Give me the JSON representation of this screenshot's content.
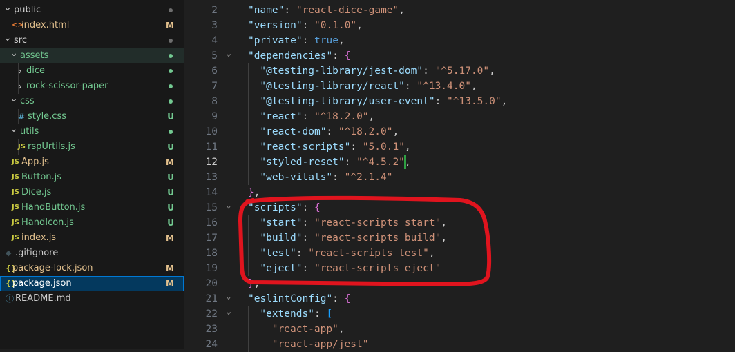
{
  "explorer": {
    "items": [
      {
        "label": "public",
        "icon": "chevron-down-icon",
        "status": "dot",
        "status_color": "#6e6e6e"
      },
      {
        "label": "index.html",
        "icon": "html-file-icon",
        "status": "M",
        "status_color": "#e2c08d",
        "label_color": "#e2c08d"
      },
      {
        "label": "src",
        "icon": "chevron-down-icon",
        "status": "dot",
        "status_color": "#6e6e6e"
      },
      {
        "label": "assets",
        "icon": "chevron-down-icon",
        "status": "dot",
        "status_color": "#73c991",
        "label_color": "#73c991"
      },
      {
        "label": "dice",
        "icon": "chevron-right-icon",
        "status": "dot",
        "status_color": "#73c991",
        "label_color": "#73c991"
      },
      {
        "label": "rock-scissor-paper",
        "icon": "chevron-right-icon",
        "status": "dot",
        "status_color": "#73c991",
        "label_color": "#73c991"
      },
      {
        "label": "css",
        "icon": "chevron-down-icon",
        "status": "dot",
        "status_color": "#73c991",
        "label_color": "#73c991"
      },
      {
        "label": "style.css",
        "icon": "css-file-icon",
        "icon_text": "#",
        "status": "U",
        "status_color": "#73c991",
        "label_color": "#73c991"
      },
      {
        "label": "utils",
        "icon": "chevron-down-icon",
        "status": "dot",
        "status_color": "#73c991",
        "label_color": "#73c991"
      },
      {
        "label": "rspUrtils.js",
        "icon": "js-file-icon",
        "icon_text": "JS",
        "status": "U",
        "status_color": "#73c991",
        "label_color": "#73c991"
      },
      {
        "label": "App.js",
        "icon": "js-file-icon",
        "icon_text": "JS",
        "status": "M",
        "status_color": "#e2c08d",
        "label_color": "#e2c08d"
      },
      {
        "label": "Button.js",
        "icon": "js-file-icon",
        "icon_text": "JS",
        "status": "U",
        "status_color": "#73c991",
        "label_color": "#73c991"
      },
      {
        "label": "Dice.js",
        "icon": "js-file-icon",
        "icon_text": "JS",
        "status": "U",
        "status_color": "#73c991",
        "label_color": "#73c991"
      },
      {
        "label": "HandButton.js",
        "icon": "js-file-icon",
        "icon_text": "JS",
        "status": "U",
        "status_color": "#73c991",
        "label_color": "#73c991"
      },
      {
        "label": "HandIcon.js",
        "icon": "js-file-icon",
        "icon_text": "JS",
        "status": "U",
        "status_color": "#73c991",
        "label_color": "#73c991"
      },
      {
        "label": "index.js",
        "icon": "js-file-icon",
        "icon_text": "JS",
        "status": "M",
        "status_color": "#e2c08d",
        "label_color": "#e2c08d"
      },
      {
        "label": ".gitignore",
        "icon": "git-icon",
        "status": "",
        "label_color": "#cccccc"
      },
      {
        "label": "package-lock.json",
        "icon": "json-file-icon",
        "icon_text": "{}",
        "status": "M",
        "status_color": "#e2c08d",
        "label_color": "#e2c08d"
      },
      {
        "label": "package.json",
        "icon": "json-file-icon",
        "icon_text": "{}",
        "status": "M",
        "status_color": "#e2c08d",
        "label_color": "#e2c08d",
        "selected": true
      },
      {
        "label": "README.md",
        "icon": "info-file-icon",
        "status": "",
        "label_color": "#cccccc"
      }
    ]
  },
  "editor": {
    "lines": [
      {
        "n": "2",
        "tokens": [
          [
            "k",
            "\"name\""
          ],
          [
            "p",
            ": "
          ],
          [
            "s",
            "\"react-dice-game\""
          ],
          [
            "p",
            ","
          ]
        ],
        "indent": 1
      },
      {
        "n": "3",
        "tokens": [
          [
            "k",
            "\"version\""
          ],
          [
            "p",
            ": "
          ],
          [
            "s",
            "\"0.1.0\""
          ],
          [
            "p",
            ","
          ]
        ],
        "indent": 1
      },
      {
        "n": "4",
        "tokens": [
          [
            "k",
            "\"private\""
          ],
          [
            "p",
            ": "
          ],
          [
            "b",
            "true"
          ],
          [
            "p",
            ","
          ]
        ],
        "indent": 1
      },
      {
        "n": "5",
        "tokens": [
          [
            "k",
            "\"dependencies\""
          ],
          [
            "p",
            ": "
          ],
          [
            "br2",
            "{"
          ]
        ],
        "indent": 1,
        "fold": true
      },
      {
        "n": "6",
        "tokens": [
          [
            "k",
            "\"@testing-library/jest-dom\""
          ],
          [
            "p",
            ": "
          ],
          [
            "s",
            "\"^5.17.0\""
          ],
          [
            "p",
            ","
          ]
        ],
        "indent": 2
      },
      {
        "n": "7",
        "tokens": [
          [
            "k",
            "\"@testing-library/react\""
          ],
          [
            "p",
            ": "
          ],
          [
            "s",
            "\"^13.4.0\""
          ],
          [
            "p",
            ","
          ]
        ],
        "indent": 2
      },
      {
        "n": "8",
        "tokens": [
          [
            "k",
            "\"@testing-library/user-event\""
          ],
          [
            "p",
            ": "
          ],
          [
            "s",
            "\"^13.5.0\""
          ],
          [
            "p",
            ","
          ]
        ],
        "indent": 2
      },
      {
        "n": "9",
        "tokens": [
          [
            "k",
            "\"react\""
          ],
          [
            "p",
            ": "
          ],
          [
            "s",
            "\"^18.2.0\""
          ],
          [
            "p",
            ","
          ]
        ],
        "indent": 2
      },
      {
        "n": "10",
        "tokens": [
          [
            "k",
            "\"react-dom\""
          ],
          [
            "p",
            ": "
          ],
          [
            "s",
            "\"^18.2.0\""
          ],
          [
            "p",
            ","
          ]
        ],
        "indent": 2
      },
      {
        "n": "11",
        "tokens": [
          [
            "k",
            "\"react-scripts\""
          ],
          [
            "p",
            ": "
          ],
          [
            "s",
            "\"5.0.1\""
          ],
          [
            "p",
            ","
          ]
        ],
        "indent": 2
      },
      {
        "n": "12",
        "tokens": [
          [
            "k",
            "\"styled-reset\""
          ],
          [
            "p",
            ": "
          ],
          [
            "s",
            "\"^4.5.2\""
          ],
          [
            "p",
            ","
          ]
        ],
        "indent": 2
      },
      {
        "n": "13",
        "tokens": [
          [
            "k",
            "\"web-vitals\""
          ],
          [
            "p",
            ": "
          ],
          [
            "s",
            "\"^2.1.4\""
          ]
        ],
        "indent": 2
      },
      {
        "n": "14",
        "tokens": [
          [
            "br2",
            "}"
          ],
          [
            "p",
            ","
          ]
        ],
        "indent": 1
      },
      {
        "n": "15",
        "tokens": [
          [
            "k",
            "\"scripts\""
          ],
          [
            "p",
            ": "
          ],
          [
            "br2",
            "{"
          ]
        ],
        "indent": 1,
        "fold": true
      },
      {
        "n": "16",
        "tokens": [
          [
            "k",
            "\"start\""
          ],
          [
            "p",
            ": "
          ],
          [
            "s",
            "\"react-scripts start\""
          ],
          [
            "p",
            ","
          ]
        ],
        "indent": 2
      },
      {
        "n": "17",
        "tokens": [
          [
            "k",
            "\"build\""
          ],
          [
            "p",
            ": "
          ],
          [
            "s",
            "\"react-scripts build\""
          ],
          [
            "p",
            ","
          ]
        ],
        "indent": 2
      },
      {
        "n": "18",
        "tokens": [
          [
            "k",
            "\"test\""
          ],
          [
            "p",
            ": "
          ],
          [
            "s",
            "\"react-scripts test\""
          ],
          [
            "p",
            ","
          ]
        ],
        "indent": 2
      },
      {
        "n": "19",
        "tokens": [
          [
            "k",
            "\"eject\""
          ],
          [
            "p",
            ": "
          ],
          [
            "s",
            "\"react-scripts eject\""
          ]
        ],
        "indent": 2
      },
      {
        "n": "20",
        "tokens": [
          [
            "br2",
            "}"
          ],
          [
            "p",
            ","
          ]
        ],
        "indent": 1
      },
      {
        "n": "21",
        "tokens": [
          [
            "k",
            "\"eslintConfig\""
          ],
          [
            "p",
            ": "
          ],
          [
            "br2",
            "{"
          ]
        ],
        "indent": 1,
        "fold": true
      },
      {
        "n": "22",
        "tokens": [
          [
            "k",
            "\"extends\""
          ],
          [
            "p",
            ": "
          ],
          [
            "br3",
            "["
          ]
        ],
        "indent": 2,
        "fold": true
      },
      {
        "n": "23",
        "tokens": [
          [
            "s",
            "\"react-app\""
          ],
          [
            "p",
            ","
          ]
        ],
        "indent": 3
      },
      {
        "n": "24",
        "tokens": [
          [
            "s",
            "\"react-app/jest\""
          ]
        ],
        "indent": 3
      }
    ],
    "annotation_color": "#e0141e",
    "modified_line": "12"
  }
}
